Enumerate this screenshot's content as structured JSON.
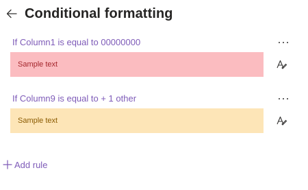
{
  "header": {
    "title": "Conditional formatting",
    "back_icon": "arrow-left-icon"
  },
  "rules": [
    {
      "title": "If Column1 is equal to 00000000",
      "sample_text": "Sample text",
      "background": "#fbbcc0",
      "text_color": "#a4262c",
      "more_icon": "more-options-icon",
      "format_icon": "format-painter-icon"
    },
    {
      "title": "If Column9 is equal to + 1 other",
      "sample_text": "Sample text",
      "background": "#fde5b7",
      "text_color": "#8a5a00",
      "more_icon": "more-options-icon",
      "format_icon": "format-painter-icon"
    }
  ],
  "add_rule": {
    "label": "Add rule",
    "icon": "plus-icon"
  },
  "colors": {
    "accent": "#7e5bb8",
    "title": "#252423"
  }
}
